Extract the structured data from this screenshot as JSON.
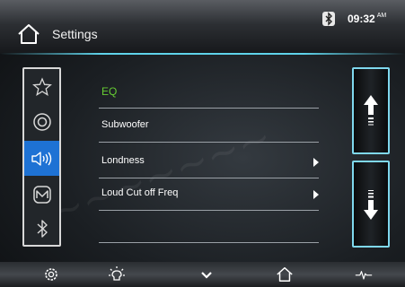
{
  "header": {
    "title": "Settings",
    "time": "09:32",
    "ampm": "AM",
    "home_icon": "home-icon",
    "bluetooth_icon": "bluetooth-status-icon"
  },
  "sidebar": {
    "items": [
      {
        "icon": "star-icon",
        "active": false
      },
      {
        "icon": "disc-icon",
        "active": false
      },
      {
        "icon": "speaker-icon",
        "active": true
      },
      {
        "icon": "logo-icon",
        "active": false
      },
      {
        "icon": "bluetooth-icon",
        "active": false
      }
    ]
  },
  "menu": {
    "items": [
      {
        "label": "EQ",
        "highlight": true,
        "has_arrow": false
      },
      {
        "label": "Subwoofer",
        "highlight": false,
        "has_arrow": false
      },
      {
        "label": "Londness",
        "highlight": false,
        "has_arrow": true
      },
      {
        "label": "Loud Cut off Freq",
        "highlight": false,
        "has_arrow": true
      }
    ]
  },
  "scroll": {
    "up_icon": "scroll-up-arrow-icon",
    "down_icon": "scroll-down-arrow-icon"
  },
  "bottom_bar": {
    "icons": [
      "gear-icon",
      "brightness-icon",
      "chevron-down-icon",
      "home-icon",
      "waveform-icon"
    ]
  },
  "colors": {
    "accent_blue": "#1e72d4",
    "highlight_green": "#66cc33",
    "scroll_border": "#7fd8ee",
    "header_line": "#5fd3ea"
  }
}
